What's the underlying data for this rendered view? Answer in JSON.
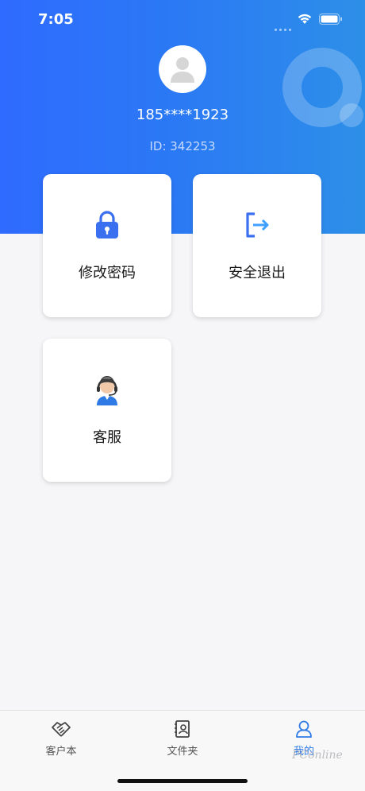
{
  "status_bar": {
    "time": "7:05"
  },
  "profile": {
    "phone": "185****1923",
    "id_text": "ID: 342253"
  },
  "cards": [
    {
      "label": "修改密码",
      "icon": "lock-icon",
      "color": "#3a6ff0"
    },
    {
      "label": "安全退出",
      "icon": "logout-icon",
      "color": "#3a6ff0"
    },
    {
      "label": "客服",
      "icon": "customer-service-icon",
      "color": "#2f7ae5"
    }
  ],
  "tabbar": {
    "tabs": [
      {
        "label": "客户本",
        "icon": "handshake-icon"
      },
      {
        "label": "文件夹",
        "icon": "contact-book-icon"
      },
      {
        "label": "我的",
        "icon": "person-icon",
        "active": true
      }
    ]
  },
  "watermark": {
    "text": "PConline"
  },
  "colors": {
    "accent": "#2f7ae5",
    "hero_start": "#2f6bff",
    "hero_end": "#2d8fe8"
  }
}
